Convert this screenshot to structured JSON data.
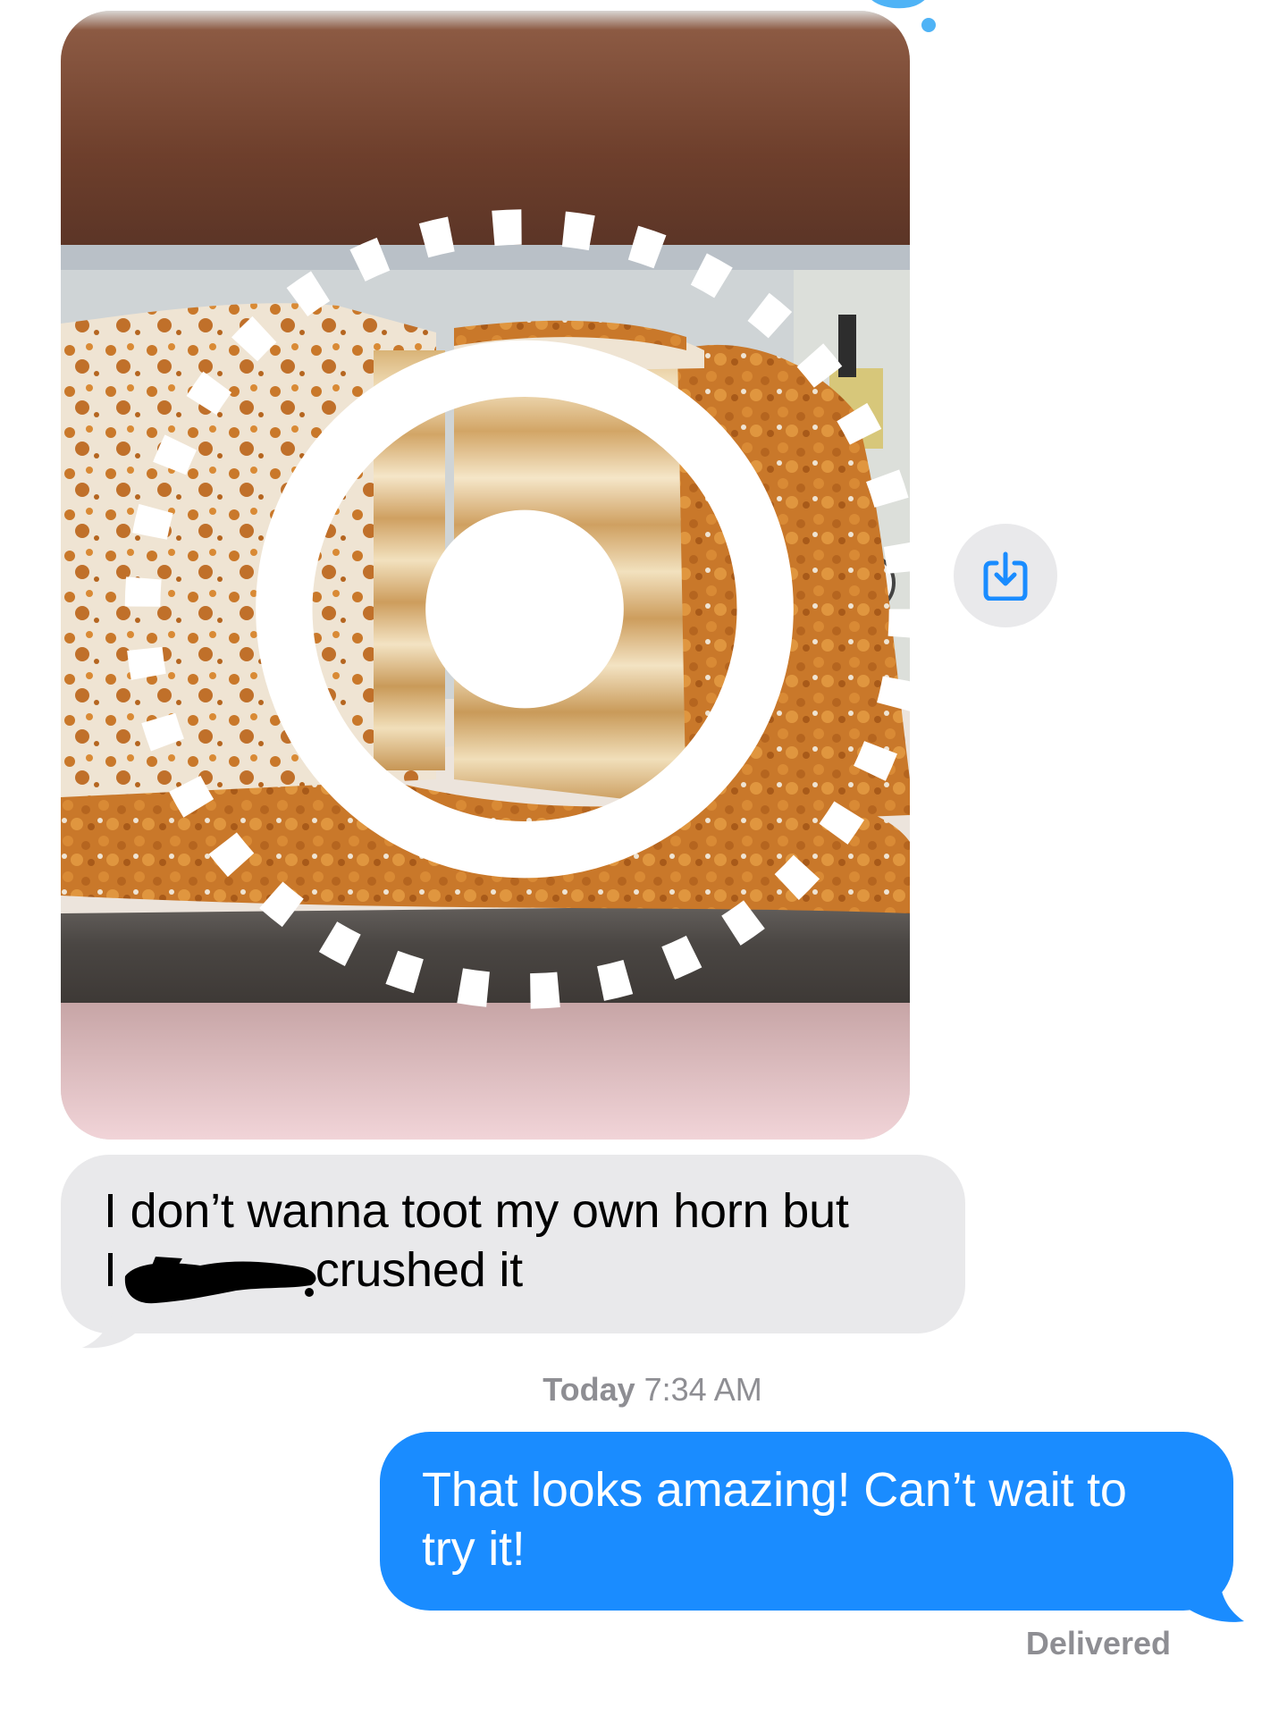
{
  "thread": {
    "photo": {
      "alt": "",
      "badge_icon": "live-photo-icon"
    },
    "share_button": {
      "icon": "save-to-photos-icon"
    },
    "received_message": {
      "line1": "I don’t wanna toot my own horn but",
      "line2_prefix": "I",
      "line2_suffix": "crushed it",
      "redaction_color": "#000000"
    },
    "timestamp": {
      "day": "Today",
      "time": "7:34 AM"
    },
    "sent_message": {
      "text": "That looks amazing! Can’t wait to try it!"
    },
    "status": "Delivered"
  },
  "colors": {
    "received_bubble": "#e9e9eb",
    "sent_bubble": "#1a8cff",
    "meta_text": "#8e8e93",
    "share_icon": "#1a8cff"
  }
}
